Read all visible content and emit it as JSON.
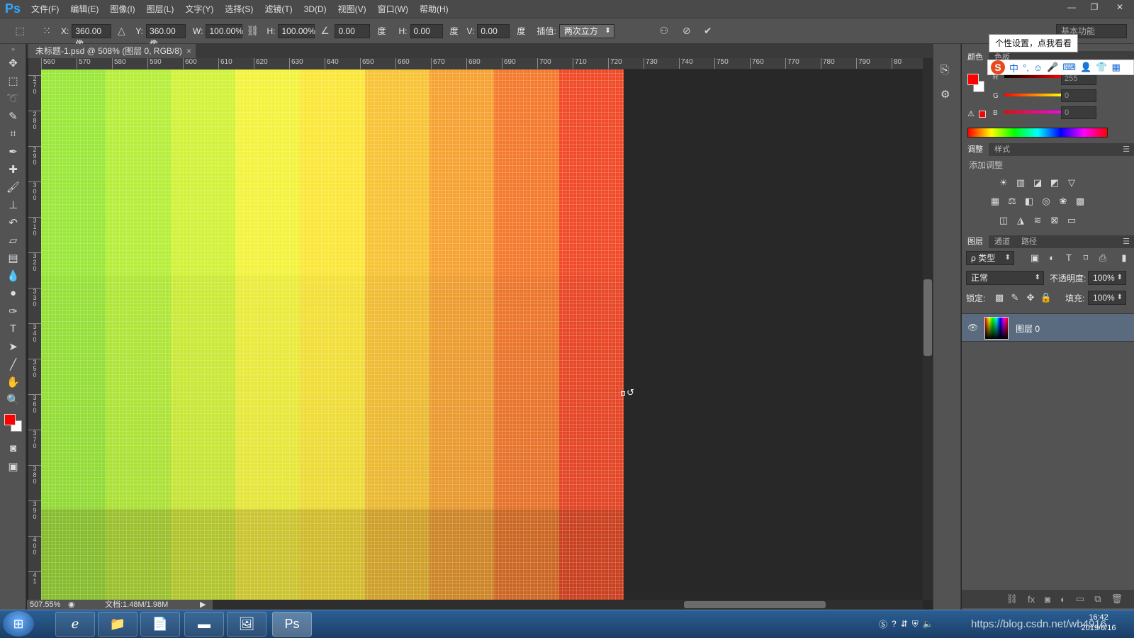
{
  "app": {
    "logo": "Ps",
    "colors": {
      "accent": "#31a8ff",
      "selection": "#5a6b80",
      "panel": "#535353",
      "canvas_bg": "#282828"
    }
  },
  "menu": [
    "文件(F)",
    "编辑(E)",
    "图像(I)",
    "图层(L)",
    "文字(Y)",
    "选择(S)",
    "滤镜(T)",
    "3D(D)",
    "视图(V)",
    "窗口(W)",
    "帮助(H)"
  ],
  "window_controls": {
    "minimize": "—",
    "restore": "❐",
    "close": "✕"
  },
  "options": {
    "x_label": "X:",
    "x_value": "360.00 像",
    "y_label": "Y:",
    "y_value": "360.00 像",
    "w_label": "W:",
    "w_value": "100.00%",
    "h_label": "H:",
    "h_value": "100.00%",
    "angle_value": "0.00",
    "angle_unit": "度",
    "hskew_label": "H:",
    "hskew_value": "0.00",
    "hskew_unit": "度",
    "vskew_label": "V:",
    "vskew_value": "0.00",
    "vskew_unit": "度",
    "interp_label": "插值:",
    "interp_value": "两次立方",
    "workspace": "基本功能"
  },
  "document": {
    "tab_title": "未标题-1.psd @ 508% (图层 0, RGB/8)",
    "close": "×"
  },
  "ruler_h": [
    "560",
    "570",
    "580",
    "590",
    "600",
    "610",
    "620",
    "630",
    "640",
    "650",
    "660",
    "670",
    "680",
    "690",
    "700",
    "710",
    "720",
    "730",
    "740",
    "750",
    "760",
    "770",
    "780",
    "790",
    "80"
  ],
  "ruler_v": [
    "2 7 0",
    "2 8 0",
    "2 9 0",
    "3 0 0",
    "3 1 0",
    "3 2 0",
    "3 3 0",
    "3 4 0",
    "3 5 0",
    "3 6 0",
    "3 7 0",
    "3 8 0",
    "3 9 0",
    "4 0 0",
    "4 1"
  ],
  "canvas": {
    "bands": [
      "#9be83a",
      "#b6ee3a",
      "#d2f23a",
      "#f3f33e",
      "#fbe73a",
      "#f8c335",
      "#f6a232",
      "#f47a2e",
      "#f04a28"
    ]
  },
  "status": {
    "zoom": "507.55%",
    "doc": "文档:1.48M/1.98M"
  },
  "color_panel": {
    "tabs": [
      "颜色",
      "色板"
    ],
    "r_label": "R",
    "r_value": "255",
    "g_label": "G",
    "g_value": "0",
    "b_label": "B",
    "b_value": "0",
    "fg": "#ff0000",
    "bg": "#ffffff"
  },
  "adjust_panel": {
    "tabs": [
      "调整",
      "样式"
    ],
    "title": "添加调整"
  },
  "layers_panel": {
    "tabs": [
      "图层",
      "通道",
      "路径"
    ],
    "filter": "ρ 类型",
    "blend": "正常",
    "opacity_label": "不透明度:",
    "opacity_value": "100%",
    "lock_label": "锁定:",
    "fill_label": "填充:",
    "fill_value": "100%",
    "layer_name": "图层 0",
    "footer_icons": [
      "⛓",
      "fx",
      "◙",
      "◐",
      "▭",
      "⧉",
      "🗑"
    ]
  },
  "tooltip": "个性设置，点我看看",
  "ime": {
    "logo": "S",
    "mode": "中"
  },
  "taskbar": {
    "clock_time": "16:42",
    "clock_date": "2019/6/16",
    "watermark": "https://blog.csdn.net/wb4916"
  }
}
